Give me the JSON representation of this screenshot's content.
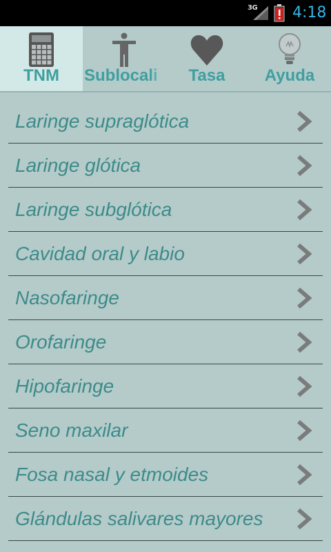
{
  "status_bar": {
    "network": "3G",
    "time": "4:18",
    "icons": [
      "signal-icon",
      "battery-icon"
    ],
    "time_color": "#33b5e5",
    "battery_color": "#cc2222"
  },
  "tabs": [
    {
      "label": "TNM",
      "icon": "calculator-icon",
      "selected": true
    },
    {
      "label": "Sublocali",
      "icon": "person-icon",
      "selected": false
    },
    {
      "label": "Tasa",
      "icon": "heart-icon",
      "selected": false
    },
    {
      "label": "Ayuda",
      "icon": "lightbulb-icon",
      "selected": false
    }
  ],
  "list": {
    "chevron_icon": "chevron-right-icon",
    "items": [
      {
        "label": "Laringe supraglótica"
      },
      {
        "label": "Laringe glótica"
      },
      {
        "label": "Laringe subglótica"
      },
      {
        "label": "Cavidad oral y labio"
      },
      {
        "label": "Nasofaringe"
      },
      {
        "label": "Orofaringe"
      },
      {
        "label": "Hipofaringe"
      },
      {
        "label": "Seno maxilar"
      },
      {
        "label": "Fosa nasal y etmoides"
      },
      {
        "label": "Glándulas salivares mayores"
      }
    ]
  },
  "theme": {
    "background": "#b4cbca",
    "selected_tab": "#d3e9e8",
    "tab_label_color": "#3f9f9f",
    "item_text_color": "#3d8b89"
  }
}
